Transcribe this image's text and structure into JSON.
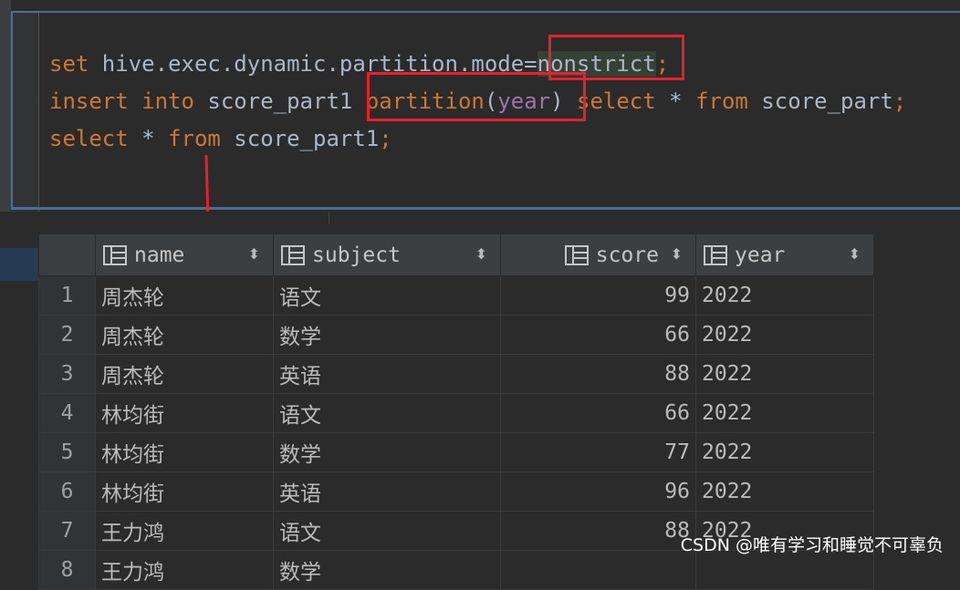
{
  "editor": {
    "lines": [
      [
        {
          "t": "set",
          "c": "kw"
        },
        {
          "t": " hive.exec.dynamic.partition.mode=",
          "c": ""
        },
        {
          "t": "nonstrict",
          "c": "hl-bg"
        },
        {
          "t": ";",
          "c": "kw"
        }
      ],
      [
        {
          "t": "insert into",
          "c": "kw"
        },
        {
          "t": " score_part1 ",
          "c": ""
        },
        {
          "t": "partition",
          "c": "kw"
        },
        {
          "t": "(",
          "c": ""
        },
        {
          "t": "year",
          "c": "yr"
        },
        {
          "t": ")",
          "c": ""
        },
        {
          "t": " select",
          "c": "kw"
        },
        {
          "t": " * ",
          "c": ""
        },
        {
          "t": "from",
          "c": "kw"
        },
        {
          "t": " score_part",
          "c": ""
        },
        {
          "t": ";",
          "c": "kw"
        }
      ],
      [
        {
          "t": "select",
          "c": "kw"
        },
        {
          "t": " * ",
          "c": ""
        },
        {
          "t": "from",
          "c": "kw"
        },
        {
          "t": " score_part1",
          "c": ""
        },
        {
          "t": ";",
          "c": "kw"
        }
      ]
    ]
  },
  "table": {
    "columns": [
      {
        "label": "name",
        "sort": "⬍"
      },
      {
        "label": "subject",
        "sort": "⬍"
      },
      {
        "label": "score",
        "sort": "⬍"
      },
      {
        "label": "year",
        "sort": "⬍"
      }
    ],
    "rows": [
      {
        "n": "1",
        "name": "周杰轮",
        "subject": "语文",
        "score": "99",
        "year": "2022"
      },
      {
        "n": "2",
        "name": "周杰轮",
        "subject": "数学",
        "score": "66",
        "year": "2022"
      },
      {
        "n": "3",
        "name": "周杰轮",
        "subject": "英语",
        "score": "88",
        "year": "2022"
      },
      {
        "n": "4",
        "name": "林均街",
        "subject": "语文",
        "score": "66",
        "year": "2022"
      },
      {
        "n": "5",
        "name": "林均街",
        "subject": "数学",
        "score": "77",
        "year": "2022"
      },
      {
        "n": "6",
        "name": "林均街",
        "subject": "英语",
        "score": "96",
        "year": "2022"
      },
      {
        "n": "7",
        "name": "王力鸿",
        "subject": "语文",
        "score": "88",
        "year": "2022"
      },
      {
        "n": "8",
        "name": "王力鸿",
        "subject": "数学",
        "score": "",
        "year": ""
      }
    ]
  },
  "watermark": "CSDN @唯有学习和睡觉不可辜负",
  "colors": {
    "keyword": "#cc7832",
    "identifier": "#a9b7c6",
    "year": "#9876aa",
    "annotation": "#e8202a"
  }
}
